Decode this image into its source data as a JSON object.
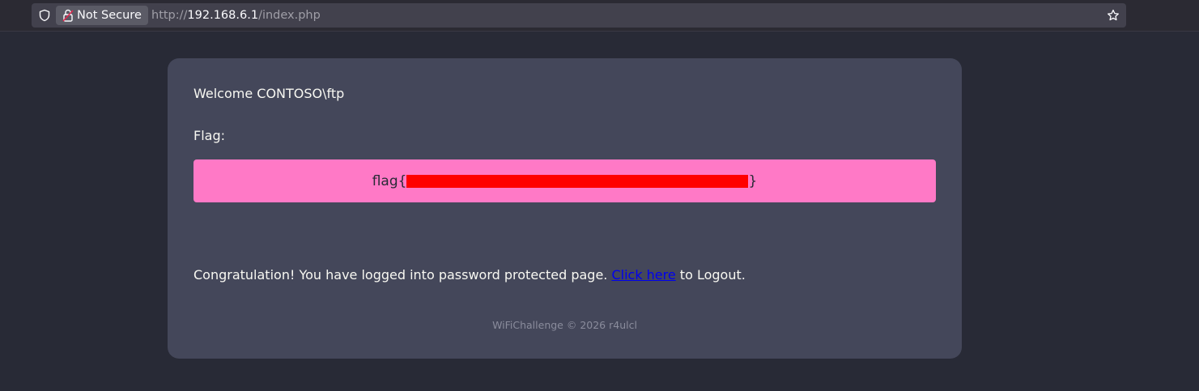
{
  "browser": {
    "security_label": "Not Secure",
    "url_scheme": "http://",
    "url_host": "192.168.6.1",
    "url_path": "/index.php"
  },
  "card": {
    "welcome_text": "Welcome CONTOSO\\ftp",
    "flag_label": "Flag:",
    "flag_prefix": "flag{",
    "flag_suffix": "}",
    "congrats_before": "Congratulation! You have logged into password protected page. ",
    "logout_link": "Click here",
    "congrats_after": " to Logout.",
    "footer": "WiFiChallenge © 2026 r4ulcl"
  },
  "colors": {
    "page_bg": "#282a36",
    "card_bg": "#44475a",
    "flag_bg": "#ff79c6",
    "redaction": "#ff0000",
    "link": "#0000ee"
  }
}
